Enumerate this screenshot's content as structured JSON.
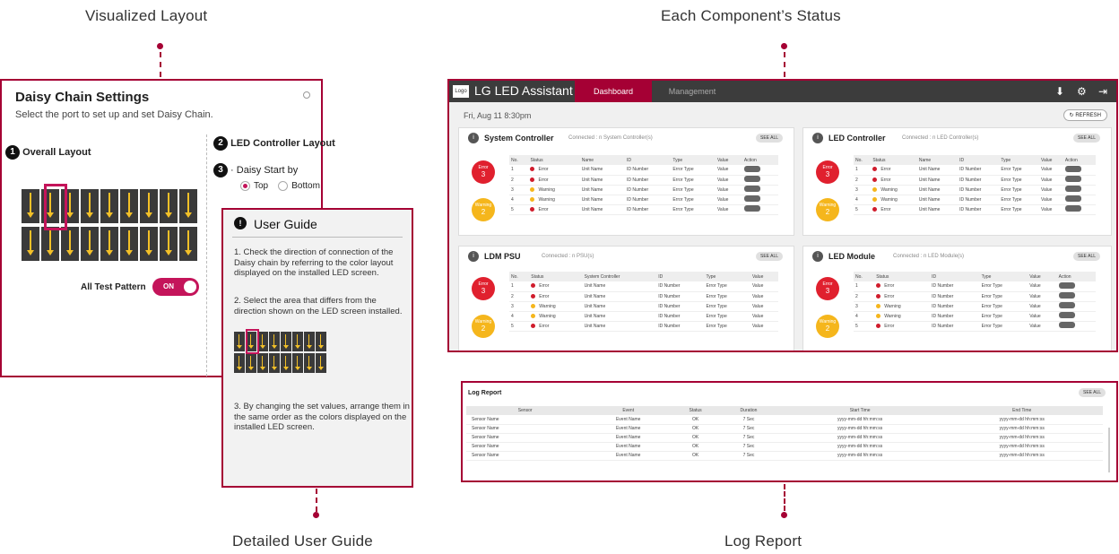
{
  "callouts": {
    "visualized_layout": "Visualized Layout",
    "component_status": "Each Component’s Status",
    "user_guide": "Detailed User Guide",
    "log_report": "Log Report"
  },
  "daisy": {
    "title": "Daisy Chain Settings",
    "subtitle": "Select the port to set up and set Daisy Chain.",
    "step1": "Overall Layout",
    "step2": "LED Controller Layout",
    "step3": "Daisy Start by",
    "radio_top": "Top",
    "radio_bottom": "Bottom",
    "test_pattern_label": "All Test Pattern",
    "toggle_on": "ON"
  },
  "guide": {
    "title": "User Guide",
    "icon": "!",
    "p1": "1. Check the direction of connection of the Daisy chain by referring to the color layout displayed on the installed LED screen.",
    "p2": "2. Select the area that differs from the direction shown on the LED screen installed.",
    "p3": "3. By changing the set values, arrange them in the same order as the colors displayed on the installed LED screen."
  },
  "dashboard": {
    "logo": "Logo",
    "app_title": "LG LED Assistant",
    "tabs": [
      "Dashboard",
      "Management"
    ],
    "date": "Fri, Aug 11 8:30pm",
    "refresh": "REFRESH",
    "see_all": "SEE ALL",
    "error_label": "Error",
    "warning_label": "Warning",
    "panels": {
      "system_controller": {
        "title": "System Controller",
        "connected": "Connected : n System Controller(s)",
        "error": "3",
        "warning": "2"
      },
      "led_controller": {
        "title": "LED Controller",
        "connected": "Connected : n LED Controller(s)",
        "error": "3",
        "warning": "2"
      },
      "ldm_psu": {
        "title": "LDM PSU",
        "connected": "Connected : n PSU(s)",
        "error": "3",
        "warning": "2"
      },
      "led_module": {
        "title": "LED Module",
        "connected": "Connected : n LED Module(s)",
        "error": "3",
        "warning": "2"
      }
    },
    "table_headers": {
      "system": [
        "No.",
        "Status",
        "Name",
        "ID",
        "Type",
        "Value",
        "Action"
      ],
      "psu": [
        "No.",
        "Status",
        "System Controller",
        "ID",
        "Type",
        "Value"
      ],
      "module": [
        "No.",
        "Status",
        "ID",
        "Type",
        "Value",
        "Action"
      ]
    },
    "rows": [
      {
        "no": "1",
        "status": "Error",
        "name": "Unit Name",
        "id": "ID Number",
        "type": "Error Type",
        "value": "Value"
      },
      {
        "no": "2",
        "status": "Error",
        "name": "Unit Name",
        "id": "ID Number",
        "type": "Error Type",
        "value": "Value"
      },
      {
        "no": "3",
        "status": "Warning",
        "name": "Unit Name",
        "id": "ID Number",
        "type": "Error Type",
        "value": "Value"
      },
      {
        "no": "4",
        "status": "Warning",
        "name": "Unit Name",
        "id": "ID Number",
        "type": "Error Type",
        "value": "Value"
      },
      {
        "no": "5",
        "status": "Error",
        "name": "Unit Name",
        "id": "ID Number",
        "type": "Error Type",
        "value": "Value"
      }
    ]
  },
  "log": {
    "title": "Log Report",
    "see_all": "SEE ALL",
    "headers": [
      "Sensor",
      "Event",
      "Status",
      "Duration",
      "Start Time",
      "End Time"
    ],
    "rows": [
      [
        "Sensor Name",
        "Event Name",
        "OK",
        "7 Sec",
        "yyyy-mm-dd hh:mm:ss",
        "yyyy-mm-dd hh:mm:ss"
      ],
      [
        "Sensor Name",
        "Event Name",
        "OK",
        "7 Sec",
        "yyyy-mm-dd hh:mm:ss",
        "yyyy-mm-dd hh:mm:ss"
      ],
      [
        "Sensor Name",
        "Event Name",
        "OK",
        "7 Sec",
        "yyyy-mm-dd hh:mm:ss",
        "yyyy-mm-dd hh:mm:ss"
      ],
      [
        "Sensor Name",
        "Event Name",
        "OK",
        "7 Sec",
        "yyyy-mm-dd hh:mm:ss",
        "yyyy-mm-dd hh:mm:ss"
      ],
      [
        "Sensor Name",
        "Event Name",
        "OK",
        "7 Sec",
        "yyyy-mm-dd hh:mm:ss",
        "yyyy-mm-dd hh:mm:ss"
      ]
    ]
  },
  "colors": {
    "accent": "#a50034",
    "error": "#e0202e",
    "warning": "#f5b61c",
    "toggle": "#c4145a"
  }
}
